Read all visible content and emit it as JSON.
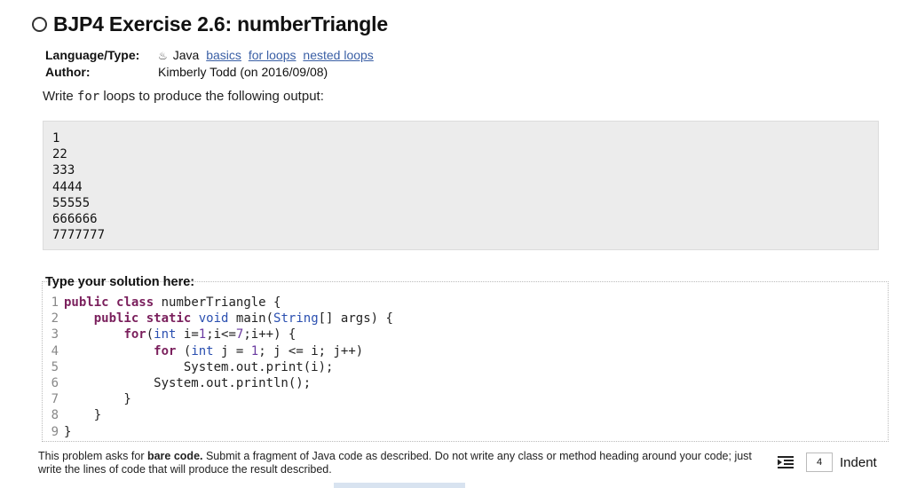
{
  "title": "BJP4 Exercise 2.6: numberTriangle",
  "meta": {
    "language_label": "Language/Type:",
    "language_value": "Java",
    "tags": [
      "basics",
      "for loops",
      "nested loops"
    ],
    "author_label": "Author:",
    "author_value": "Kimberly Todd (on 2016/09/08)"
  },
  "prompt": {
    "before": "Write ",
    "code": "for",
    "after": " loops to produce the following output:"
  },
  "expected_output": [
    "1",
    "22",
    "333",
    "4444",
    "55555",
    "666666",
    "7777777"
  ],
  "solution": {
    "label": "Type your solution here:",
    "line_numbers": [
      "1",
      "2",
      "3",
      "4",
      "5",
      "6",
      "7",
      "8",
      "9"
    ]
  },
  "footer": {
    "t1": "This problem asks for ",
    "bold": "bare code.",
    "t2": " Submit a fragment of Java code as described. Do not write any class or method heading around your code; just write the lines of code that will produce the result described."
  },
  "indent": {
    "value": "4",
    "label": "Indent"
  },
  "icons": {
    "status": "status-circle-icon",
    "java": "java-cup-icon",
    "indent": "indent-lines-icon"
  }
}
